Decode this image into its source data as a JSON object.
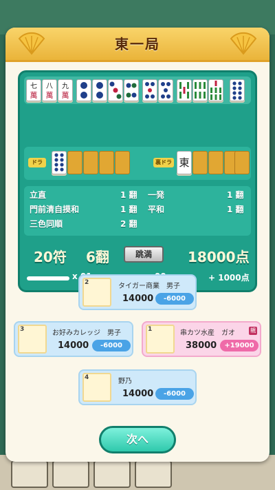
{
  "title": "東一局",
  "hand_tiles": [
    "七萬",
    "八萬",
    "九萬",
    "2筒",
    "2筒",
    "3筒",
    "4筒",
    "5筒",
    "5筒",
    "5索",
    "6索",
    "7索",
    "8筒"
  ],
  "dora": {
    "label": "ドラ",
    "tiles": [
      "8筒"
    ],
    "hidden_count": 4
  },
  "uradora": {
    "label": "裏ドラ",
    "tiles": [
      "東"
    ],
    "hidden_count": 4
  },
  "yaku": [
    {
      "name": "立直",
      "han": "1 翻"
    },
    {
      "name": "一発",
      "han": "1 翻"
    },
    {
      "name": "門前清自摸和",
      "han": "1 翻"
    },
    {
      "name": "平和",
      "han": "1 翻"
    },
    {
      "name": "三色同順",
      "han": "2 翻"
    }
  ],
  "summary": {
    "fu": "20符",
    "han": "6翻",
    "rank_label": "跳満",
    "points": "18000点"
  },
  "sticks": {
    "riichi": "x 01",
    "honba": "x 00",
    "bonus": "+ 1000点"
  },
  "players": [
    {
      "rank": "2",
      "name": "タイガー商業　男子",
      "points": "14000",
      "delta": "-6000"
    },
    {
      "rank": "3",
      "name": "お好みカレッジ　男子",
      "points": "14000",
      "delta": "-6000"
    },
    {
      "rank": "1",
      "name": "串カツ水産　ガオ",
      "points": "38000",
      "delta": "+19000",
      "oya": "親"
    },
    {
      "rank": "4",
      "name": "野乃",
      "points": "14000",
      "delta": "-6000"
    }
  ],
  "next_label": "次へ",
  "colors": {
    "panel": "#1fa08a",
    "header": "#eab43a",
    "accent": "#2fc9ac"
  }
}
